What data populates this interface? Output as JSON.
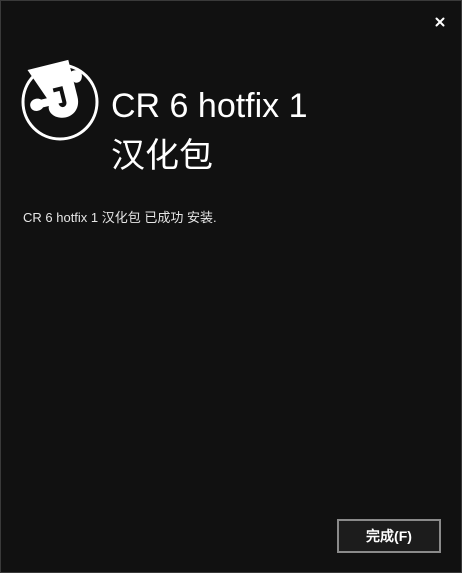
{
  "window": {
    "close_icon": "close-icon"
  },
  "header": {
    "logo_icon": "puzzle-piece-logo-icon",
    "title_line1": "CR 6 hotfix 1",
    "title_line2": "汉化包"
  },
  "main": {
    "status_message": "CR 6 hotfix 1 汉化包 已成功 安装."
  },
  "footer": {
    "finish_label": "完成(F)"
  }
}
